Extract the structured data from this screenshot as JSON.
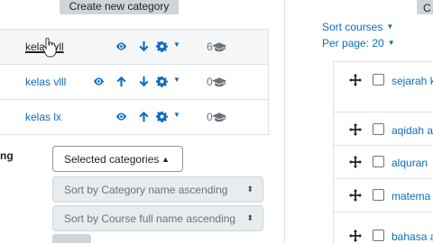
{
  "left": {
    "create_button": "Create new category",
    "categories": [
      {
        "name": "kelas vll",
        "count": "6"
      },
      {
        "name": "kelas vlll",
        "count": "0"
      },
      {
        "name": "kelas lx",
        "count": "0"
      }
    ],
    "sort_label": "ng",
    "selected_categories_button": "Selected categories",
    "sort_category_select": "Sort by Category name ascending",
    "sort_course_select": "Sort by Course full name ascending"
  },
  "right": {
    "top_button": "C",
    "sort_courses": "Sort courses",
    "per_page": "Per page: 20",
    "courses": [
      {
        "name": "sejarah k"
      },
      {
        "name": "aqidah a"
      },
      {
        "name": "alquran"
      },
      {
        "name": "matema"
      },
      {
        "name": "bahasa a"
      }
    ]
  },
  "colors": {
    "link": "#0f6cbf",
    "button_bg": "#ced4da",
    "border": "#dee2e6",
    "disabled_bg": "#e9ecef"
  },
  "icons": [
    "eye-icon",
    "arrow-up-icon",
    "arrow-down-icon",
    "gear-icon",
    "caret-down-icon",
    "graduation-cap-icon",
    "move-icon",
    "checkbox-icon",
    "hand-pointer-icon"
  ]
}
